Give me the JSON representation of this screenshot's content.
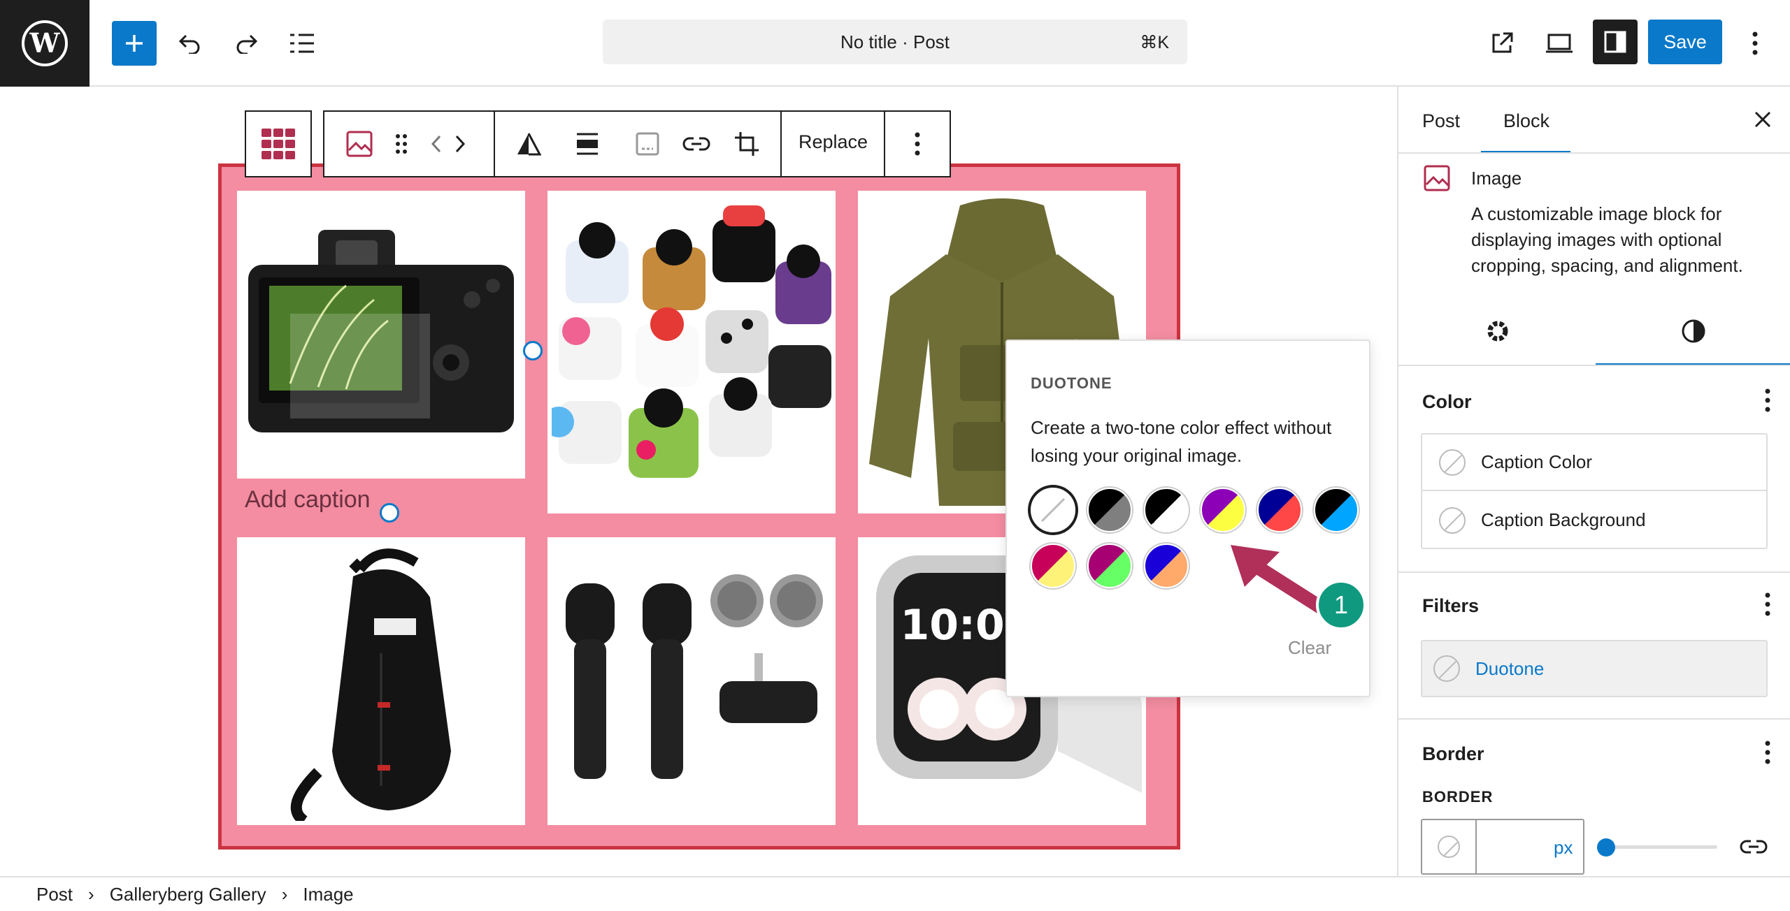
{
  "topbar": {
    "title": "No title · Post",
    "shortcut": "⌘K",
    "save_label": "Save"
  },
  "canvas": {
    "caption_placeholder": "Add caption",
    "gallery_images": [
      "camera",
      "fidget-cubes",
      "hoodie",
      "sling-bag",
      "wireless-microphones",
      "smartwatch"
    ],
    "gallery_color": "#f48da1",
    "gallery_border_color": "#cc3340"
  },
  "block_toolbar": {
    "replace_label": "Replace"
  },
  "duotone": {
    "title": "DUOTONE",
    "description": "Create a two-tone color effect without losing your original image.",
    "clear_label": "Clear",
    "swatches": [
      {
        "name": "none"
      },
      {
        "name": "dark-grayscale",
        "c1": "#000000",
        "c2": "#7f7f7f"
      },
      {
        "name": "grayscale",
        "c1": "#000000",
        "c2": "#ffffff"
      },
      {
        "name": "purple-yellow",
        "c1": "#8c00b7",
        "c2": "#fcff41"
      },
      {
        "name": "blue-red",
        "c1": "#000097",
        "c2": "#ff4747"
      },
      {
        "name": "midnight",
        "c1": "#000000",
        "c2": "#00a5ff"
      },
      {
        "name": "magenta-yellow",
        "c1": "#c7005a",
        "c2": "#fff278"
      },
      {
        "name": "purple-green",
        "c1": "#a60072",
        "c2": "#67ff66"
      },
      {
        "name": "blue-orange",
        "c1": "#1900d8",
        "c2": "#ffa96b"
      }
    ]
  },
  "annotation": {
    "badge": "1",
    "arrow_color": "#b0305a",
    "badge_color": "#0f9a80"
  },
  "sidebar": {
    "tabs": [
      "Post",
      "Block"
    ],
    "active_tab": "Block",
    "block_name": "Image",
    "block_description": "A customizable image block for displaying images with optional cropping, spacing, and alignment.",
    "color_section": "Color",
    "color_options": [
      "Caption Color",
      "Caption Background"
    ],
    "filters_section": "Filters",
    "filter_item": "Duotone",
    "border_section": "Border",
    "border_label": "BORDER",
    "border_unit": "px",
    "accent": "#0a79c9"
  },
  "breadcrumb": [
    "Post",
    "Galleryberg Gallery",
    "Image"
  ]
}
